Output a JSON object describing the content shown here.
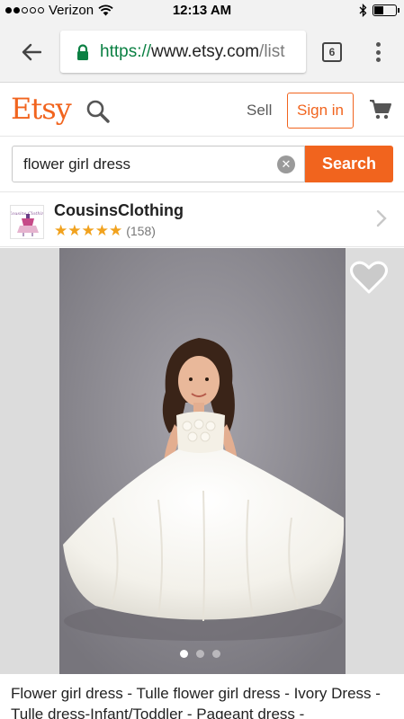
{
  "status_bar": {
    "carrier": "Verizon",
    "time": "12:13 AM"
  },
  "browser": {
    "url_scheme": "https://",
    "url_host": "www.etsy.com",
    "url_path": "/list",
    "tab_count": "6"
  },
  "header": {
    "logo": "Etsy",
    "sell_label": "Sell",
    "signin_label": "Sign in"
  },
  "search": {
    "value": "flower girl dress",
    "button_label": "Search"
  },
  "shop": {
    "name": "CousinsClothing",
    "stars": "★★★★★",
    "review_count": "(158)",
    "avatar_text": "Cousins Clothing"
  },
  "listing": {
    "title": "Flower girl dress - Tulle flower girl dress - Ivory Dress - Tulle dress-Infant/Toddler - Pageant dress -",
    "image_count": 3,
    "current_image": 1
  },
  "colors": {
    "brand": "#f1641e",
    "star": "#f1a21e",
    "url_secure": "#0b8043"
  },
  "icons": [
    "wifi-icon",
    "bluetooth-icon",
    "battery-icon",
    "back-arrow-icon",
    "lock-icon",
    "tabs-icon",
    "overflow-menu-icon",
    "search-icon",
    "cart-icon",
    "clear-icon",
    "chevron-right-icon",
    "heart-icon"
  ]
}
